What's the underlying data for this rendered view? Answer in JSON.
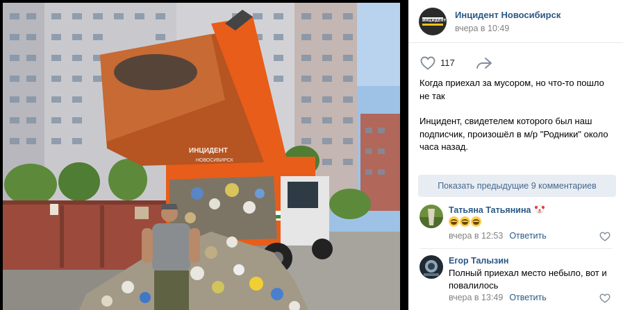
{
  "photo": {
    "watermark_line1": "ИНЦИДЕНТ",
    "watermark_line2": "НОВОСИБИРСК"
  },
  "post": {
    "group_name": "Инцидент Новосибирск",
    "time": "вчера в 10:49",
    "likes": "117",
    "text_1": "Когда приехал за мусором, но что-то пошло не так",
    "text_2": "Инцидент, свидетелем которого был наш подписчик, произошёл в м/р \"Родники\" около часа назад."
  },
  "avatar_logo_text": "ИНЦИДЕНТ",
  "prev_comments_label": "Показать предыдущие 9 комментариев",
  "comments": [
    {
      "author": "Татьяна Татьянина",
      "time": "вчера в 12:53",
      "reply_label": "Ответить"
    },
    {
      "author": "Егор Талызин",
      "text": "Полный приехал место небыло, вот и повалилось",
      "time": "вчера в 13:49",
      "reply_label": "Ответить"
    }
  ],
  "colors": {
    "link": "#2a5885",
    "meta": "#828282",
    "button_bg": "#e8edf3",
    "truck_orange": "#e85d1a"
  },
  "icons": [
    "heart-icon",
    "share-arrow-icon",
    "clown-emoji-icon",
    "laughing-emoji-icon"
  ]
}
